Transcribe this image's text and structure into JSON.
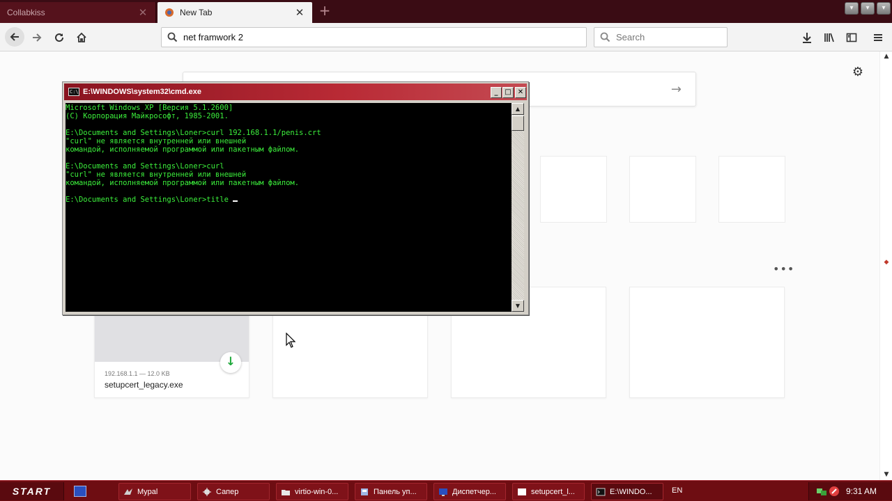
{
  "browser": {
    "tabs": [
      {
        "title": "Collabkiss",
        "active": false
      },
      {
        "title": "New Tab",
        "active": true
      }
    ],
    "url": "net framwork 2",
    "search_placeholder": "Search"
  },
  "newtab": {
    "highlight": {
      "meta": "192.168.1.1 — 12.0 KB",
      "filename": "setupcert_legacy.exe"
    }
  },
  "cmd": {
    "title": "E:\\WINDOWS\\system32\\cmd.exe",
    "lines": [
      "Microsoft Windows XP [Версия 5.1.2600]",
      "(С) Корпорация Майкрософт, 1985-2001.",
      "",
      "E:\\Documents and Settings\\Loner>curl 192.168.1.1/penis.crt",
      "\"curl\" не является внутренней или внешней",
      "командой, исполняемой программой или пакетным файлом.",
      "",
      "E:\\Documents and Settings\\Loner>curl",
      "\"curl\" не является внутренней или внешней",
      "командой, исполняемой программой или пакетным файлом.",
      "",
      "E:\\Documents and Settings\\Loner>title "
    ]
  },
  "taskbar": {
    "start_label": "START",
    "items": [
      {
        "label": "Mypal",
        "icon": "mypal-icon"
      },
      {
        "label": "Сапер",
        "icon": "minesweeper-icon"
      },
      {
        "label": "virtio-win-0...",
        "icon": "folder-icon"
      },
      {
        "label": "Панель уп...",
        "icon": "control-panel-icon"
      },
      {
        "label": "Диспетчер...",
        "icon": "task-manager-icon"
      },
      {
        "label": "setupcert_l...",
        "icon": "window-icon"
      },
      {
        "label": "E:\\WINDO...",
        "icon": "cmd-icon"
      }
    ],
    "language": "EN",
    "clock": "9:31 AM"
  },
  "colors": {
    "theme_red": "#6e0d12",
    "console_text": "#3cf03c",
    "download_green": "#1fa83b"
  }
}
